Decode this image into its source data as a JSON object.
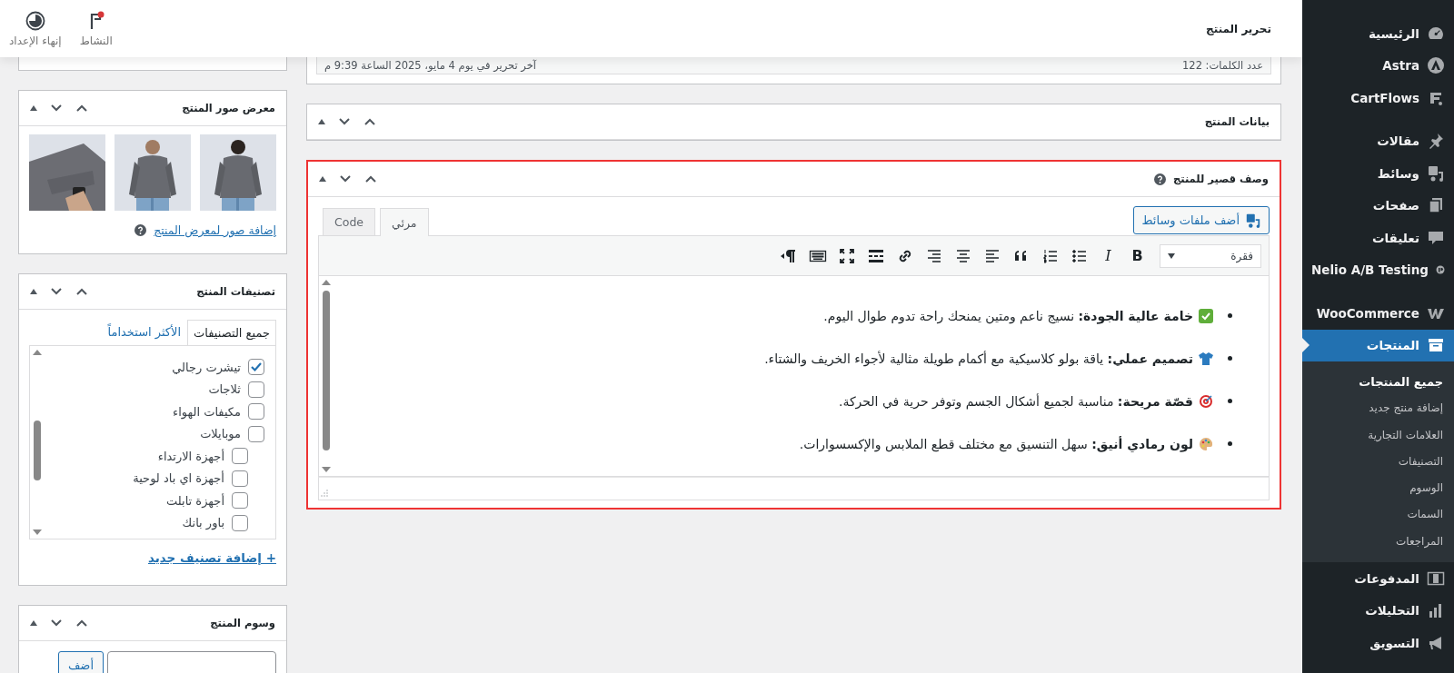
{
  "header": {
    "title": "تحرير المنتج",
    "actions": [
      {
        "kind": "activity",
        "label": "النشاط",
        "notification": true
      },
      {
        "kind": "setup",
        "label": "إنهاء الإعداد"
      }
    ]
  },
  "sidebar": {
    "groups": [
      {
        "items": [
          {
            "label": "الرئيسية",
            "kind": "dashboard",
            "selected": false
          },
          {
            "label": "Astra",
            "kind": "astra",
            "selected": false
          },
          {
            "label": "CartFlows",
            "kind": "cartflows",
            "selected": false
          }
        ]
      },
      {
        "items": [
          {
            "label": "مقالات",
            "kind": "pin",
            "selected": false
          },
          {
            "label": "وسائط",
            "kind": "media",
            "selected": false
          },
          {
            "label": "صفحات",
            "kind": "pages",
            "selected": false
          },
          {
            "label": "تعليقات",
            "kind": "comments",
            "selected": false
          },
          {
            "label": "Nelio A/B Testing",
            "kind": "nelio",
            "selected": false
          }
        ]
      },
      {
        "items": [
          {
            "label": "WooCommerce",
            "kind": "woo",
            "selected": false
          },
          {
            "label": "المنتجات",
            "kind": "archive",
            "selected": true,
            "children": [
              {
                "label": "جميع المنتجات",
                "selected": true
              },
              {
                "label": "إضافة منتج جديد",
                "selected": false
              },
              {
                "label": "العلامات التجارية",
                "selected": false
              },
              {
                "label": "التصنيفات",
                "selected": false
              },
              {
                "label": "الوسوم",
                "selected": false
              },
              {
                "label": "السمات",
                "selected": false
              },
              {
                "label": "المراجعات",
                "selected": false
              }
            ]
          },
          {
            "label": "المدفوعات",
            "kind": "money",
            "selected": false
          },
          {
            "label": "التحليلات",
            "kind": "chart",
            "selected": false
          },
          {
            "label": "التسويق",
            "kind": "megaphone",
            "selected": false
          }
        ]
      }
    ]
  },
  "word_count_bar": {
    "word_count": "عدد الكلمات: 122",
    "last_edited": "آخر تحرير في يوم 4 مايو، 2025 الساعة 9:39 م"
  },
  "product_data_panel": {
    "title": "بيانات المنتج"
  },
  "short_description_panel": {
    "title": "وصف قصير للمنتج",
    "highlighted": true,
    "add_media_button": "أضف ملفات وسائط",
    "tabs": [
      {
        "label": "مرئي",
        "selected": true
      },
      {
        "label": "Code",
        "selected": false
      }
    ],
    "format_select": "فقرة",
    "toolbar": [
      {
        "kind": "bold",
        "label": "B"
      },
      {
        "kind": "italic",
        "label": "I"
      },
      {
        "kind": "bullet-list"
      },
      {
        "kind": "numbered-list"
      },
      {
        "kind": "quote"
      },
      {
        "kind": "align-left"
      },
      {
        "kind": "align-center"
      },
      {
        "kind": "align-right"
      },
      {
        "kind": "link"
      },
      {
        "kind": "read-more"
      },
      {
        "kind": "fullscreen"
      },
      {
        "kind": "keyboard"
      },
      {
        "kind": "text-direction"
      }
    ],
    "content": [
      {
        "kind": "check",
        "text": "**خامة عالية الجودة:** نسيج ناعم ومتين يمنحك راحة تدوم طوال اليوم."
      },
      {
        "kind": "shirt",
        "text": "**تصميم عملي:** ياقة بولو كلاسيكية مع أكمام طويلة مثالية لأجواء الخريف والشتاء."
      },
      {
        "kind": "target",
        "text": "**قصّة مريحة:** مناسبة لجميع أشكال الجسم وتوفر حرية في الحركة."
      },
      {
        "kind": "palette",
        "text": "**لون رمادي أنيق:** سهل التنسيق مع مختلف قطع الملابس والإكسسوارات."
      }
    ]
  },
  "gallery_panel": {
    "title": "معرض صور المنتج",
    "add_link": "إضافة صور لمعرض المنتج"
  },
  "categories_panel": {
    "title": "تصنيفات المنتج",
    "tabs": [
      {
        "label": "جميع التصنيفات",
        "selected": true
      },
      {
        "label": "الأكثر استخداماً",
        "selected": false
      }
    ],
    "items": [
      {
        "label": "تيشرت رجالي",
        "checked": true
      },
      {
        "label": "ثلاجات",
        "checked": false
      },
      {
        "label": "مكيفات الهواء",
        "checked": false
      },
      {
        "label": "موبايلات",
        "checked": false,
        "children": [
          {
            "label": "أجهزة الارتداء",
            "checked": false
          },
          {
            "label": "أجهزة اي باد لوحية",
            "checked": false
          },
          {
            "label": "أجهزة تابلت",
            "checked": false
          },
          {
            "label": "باور بانك",
            "checked": false
          }
        ]
      }
    ],
    "add_link": "+ إضافة تصنيف جديد"
  },
  "tags_panel": {
    "title": "وسوم المنتج",
    "add_button": "أضف"
  }
}
